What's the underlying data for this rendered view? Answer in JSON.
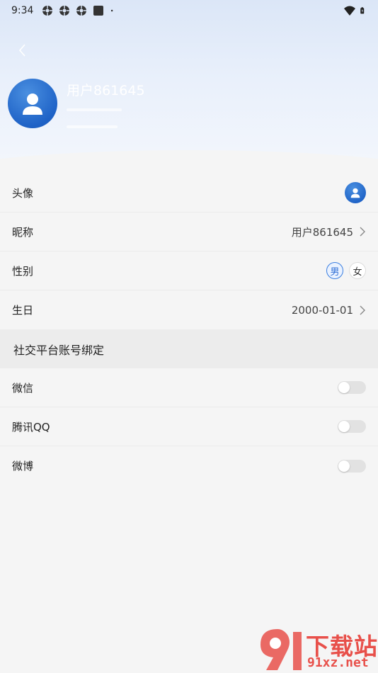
{
  "status_bar": {
    "time": "9:34",
    "notification_icons": [
      "settings-gear-icon",
      "settings-gear-icon",
      "settings-gear-icon",
      "square-app-icon",
      "dot-icon"
    ],
    "right_icons": [
      "wifi-icon",
      "battery-icon"
    ]
  },
  "header": {
    "back_icon": "chevron-left-icon",
    "user_name": "用户861645"
  },
  "profile_rows": [
    {
      "label": "头像",
      "type": "avatar"
    },
    {
      "label": "昵称",
      "value": "用户861645"
    },
    {
      "label": "性别",
      "options": [
        "男",
        "女"
      ],
      "selected": "男"
    },
    {
      "label": "生日",
      "value": "2000-01-01"
    }
  ],
  "social_section": {
    "title": "社交平台账号绑定",
    "items": [
      {
        "label": "微信",
        "bound": false
      },
      {
        "label": "腾讯QQ",
        "bound": false
      },
      {
        "label": "微博",
        "bound": false
      }
    ]
  },
  "watermark": {
    "text": "下载站",
    "url": "91xz.net"
  },
  "colors": {
    "accent": "#1f63c7",
    "background": "#f5f5f5",
    "section_bg": "#ececec",
    "toggle_off": "#e2e2e2",
    "watermark": "#e8504a"
  }
}
